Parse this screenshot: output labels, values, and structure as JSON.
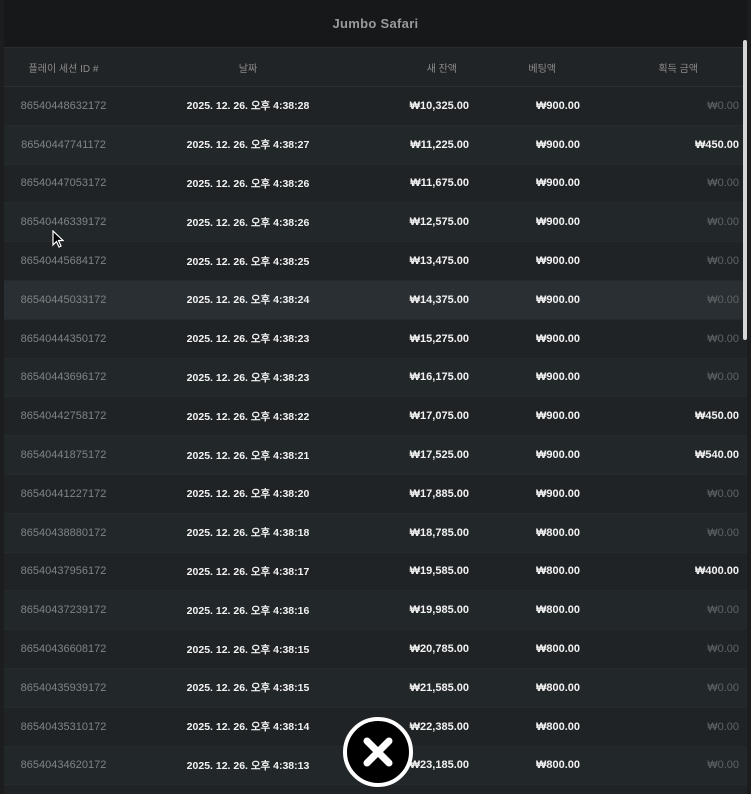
{
  "title": "Jumbo Safari",
  "columns": {
    "session_id": "플레이 세션 ID #",
    "date": "날짜",
    "balance": "새 잔액",
    "bet": "베팅액",
    "win": "획득 금액"
  },
  "rows": [
    {
      "id": "86540448632172",
      "date": "2025. 12. 26. 오후 4:38:28",
      "balance": "₩10,325.00",
      "bet": "₩900.00",
      "win": "₩0.00"
    },
    {
      "id": "86540447741172",
      "date": "2025. 12. 26. 오후 4:38:27",
      "balance": "₩11,225.00",
      "bet": "₩900.00",
      "win": "₩450.00"
    },
    {
      "id": "86540447053172",
      "date": "2025. 12. 26. 오후 4:38:26",
      "balance": "₩11,675.00",
      "bet": "₩900.00",
      "win": "₩0.00"
    },
    {
      "id": "86540446339172",
      "date": "2025. 12. 26. 오후 4:38:26",
      "balance": "₩12,575.00",
      "bet": "₩900.00",
      "win": "₩0.00"
    },
    {
      "id": "86540445684172",
      "date": "2025. 12. 26. 오후 4:38:25",
      "balance": "₩13,475.00",
      "bet": "₩900.00",
      "win": "₩0.00"
    },
    {
      "id": "86540445033172",
      "date": "2025. 12. 26. 오후 4:38:24",
      "balance": "₩14,375.00",
      "bet": "₩900.00",
      "win": "₩0.00"
    },
    {
      "id": "86540444350172",
      "date": "2025. 12. 26. 오후 4:38:23",
      "balance": "₩15,275.00",
      "bet": "₩900.00",
      "win": "₩0.00"
    },
    {
      "id": "86540443696172",
      "date": "2025. 12. 26. 오후 4:38:23",
      "balance": "₩16,175.00",
      "bet": "₩900.00",
      "win": "₩0.00"
    },
    {
      "id": "86540442758172",
      "date": "2025. 12. 26. 오후 4:38:22",
      "balance": "₩17,075.00",
      "bet": "₩900.00",
      "win": "₩450.00"
    },
    {
      "id": "86540441875172",
      "date": "2025. 12. 26. 오후 4:38:21",
      "balance": "₩17,525.00",
      "bet": "₩900.00",
      "win": "₩540.00"
    },
    {
      "id": "86540441227172",
      "date": "2025. 12. 26. 오후 4:38:20",
      "balance": "₩17,885.00",
      "bet": "₩900.00",
      "win": "₩0.00"
    },
    {
      "id": "86540438880172",
      "date": "2025. 12. 26. 오후 4:38:18",
      "balance": "₩18,785.00",
      "bet": "₩800.00",
      "win": "₩0.00"
    },
    {
      "id": "86540437956172",
      "date": "2025. 12. 26. 오후 4:38:17",
      "balance": "₩19,585.00",
      "bet": "₩800.00",
      "win": "₩400.00"
    },
    {
      "id": "86540437239172",
      "date": "2025. 12. 26. 오후 4:38:16",
      "balance": "₩19,985.00",
      "bet": "₩800.00",
      "win": "₩0.00"
    },
    {
      "id": "86540436608172",
      "date": "2025. 12. 26. 오후 4:38:15",
      "balance": "₩20,785.00",
      "bet": "₩800.00",
      "win": "₩0.00"
    },
    {
      "id": "86540435939172",
      "date": "2025. 12. 26. 오후 4:38:15",
      "balance": "₩21,585.00",
      "bet": "₩800.00",
      "win": "₩0.00"
    },
    {
      "id": "86540435310172",
      "date": "2025. 12. 26. 오후 4:38:14",
      "balance": "₩22,385.00",
      "bet": "₩800.00",
      "win": "₩0.00"
    },
    {
      "id": "86540434620172",
      "date": "2025. 12. 26. 오후 4:38:13",
      "balance": "₩23,185.00",
      "bet": "₩800.00",
      "win": "₩0.00"
    }
  ],
  "close_icon": "close-x-icon"
}
